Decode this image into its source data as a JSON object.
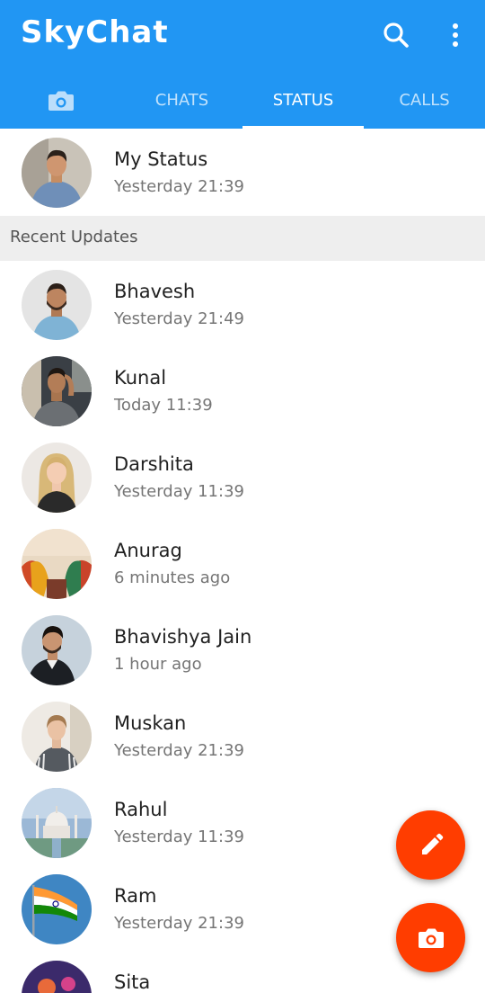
{
  "app": {
    "title": "SkyChat"
  },
  "tabs": [
    {
      "label": "",
      "icon": "camera-icon"
    },
    {
      "label": "CHATS"
    },
    {
      "label": "STATUS",
      "active": true
    },
    {
      "label": "CALLS"
    }
  ],
  "my_status": {
    "name": "My Status",
    "time": "Yesterday 21:39"
  },
  "section": {
    "title": "Recent Updates"
  },
  "updates": [
    {
      "name": "Bhavesh",
      "time": "Yesterday 21:49"
    },
    {
      "name": "Kunal",
      "time": "Today 11:39"
    },
    {
      "name": "Darshita",
      "time": "Yesterday 11:39"
    },
    {
      "name": "Anurag",
      "time": "6 minutes ago"
    },
    {
      "name": "Bhavishya Jain",
      "time": "1 hour ago"
    },
    {
      "name": "Muskan",
      "time": "Yesterday 21:39"
    },
    {
      "name": "Rahul",
      "time": "Yesterday 11:39"
    },
    {
      "name": "Ram",
      "time": "Yesterday 21:39"
    },
    {
      "name": "Sita",
      "time": ""
    }
  ],
  "colors": {
    "primary": "#2196F3",
    "accent": "#FF3D00"
  }
}
